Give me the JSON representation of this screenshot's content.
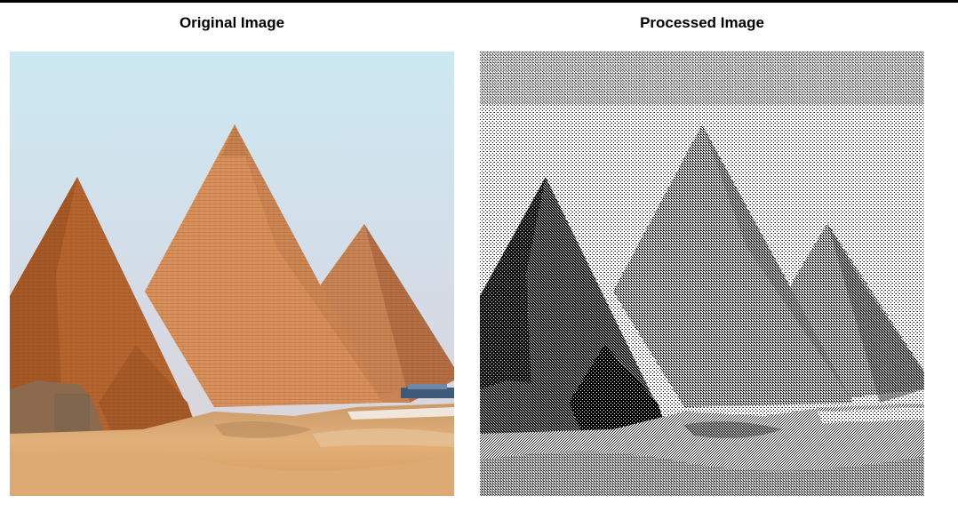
{
  "panels": {
    "original": {
      "title": "Original Image",
      "scene": "pyramids-photo"
    },
    "processed": {
      "title": "Processed Image",
      "scene": "pyramids-dithered"
    }
  },
  "colors": {
    "sky_top": "#c9e6ee",
    "sky_bottom": "#d9d3dc",
    "pyramid_lit": "#d48f5b",
    "pyramid_shadow": "#a75a28",
    "sand": "#d8a46a",
    "rule": "#000000"
  }
}
